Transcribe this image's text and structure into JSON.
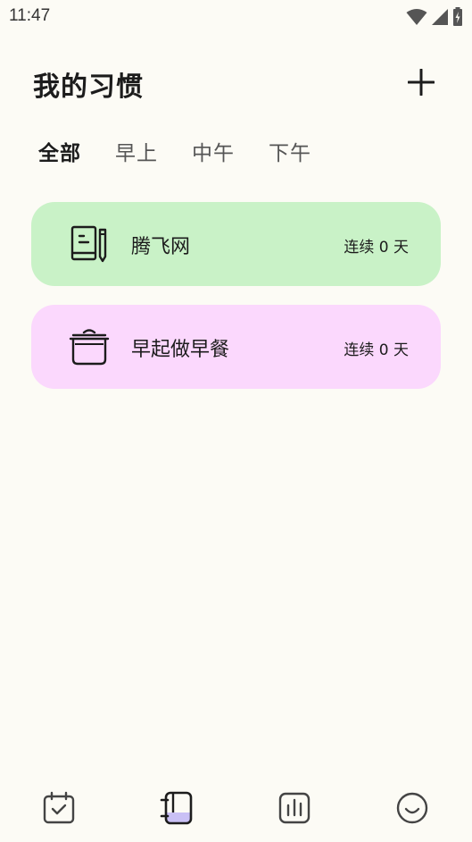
{
  "status_bar": {
    "time": "11:47"
  },
  "header": {
    "title": "我的习惯",
    "add_icon": "plus-icon"
  },
  "tabs": [
    {
      "label": "全部",
      "active": true
    },
    {
      "label": "早上",
      "active": false
    },
    {
      "label": "中午",
      "active": false
    },
    {
      "label": "下午",
      "active": false
    }
  ],
  "habits": [
    {
      "name": "腾飞网",
      "streak": "连续 0 天",
      "icon": "book-pencil-icon",
      "color": "#C9F2C7"
    },
    {
      "name": "早起做早餐",
      "streak": "连续 0 天",
      "icon": "cooking-pot-icon",
      "color": "#FBD8FD"
    }
  ],
  "bottom_nav": [
    {
      "icon": "calendar-check-icon",
      "active": false
    },
    {
      "icon": "habit-notebook-icon",
      "active": true
    },
    {
      "icon": "stats-chart-icon",
      "active": false
    },
    {
      "icon": "smiley-face-icon",
      "active": false
    }
  ],
  "colors": {
    "background": "#FCFBF5",
    "active_nav_fill": "#C9C0F5"
  }
}
